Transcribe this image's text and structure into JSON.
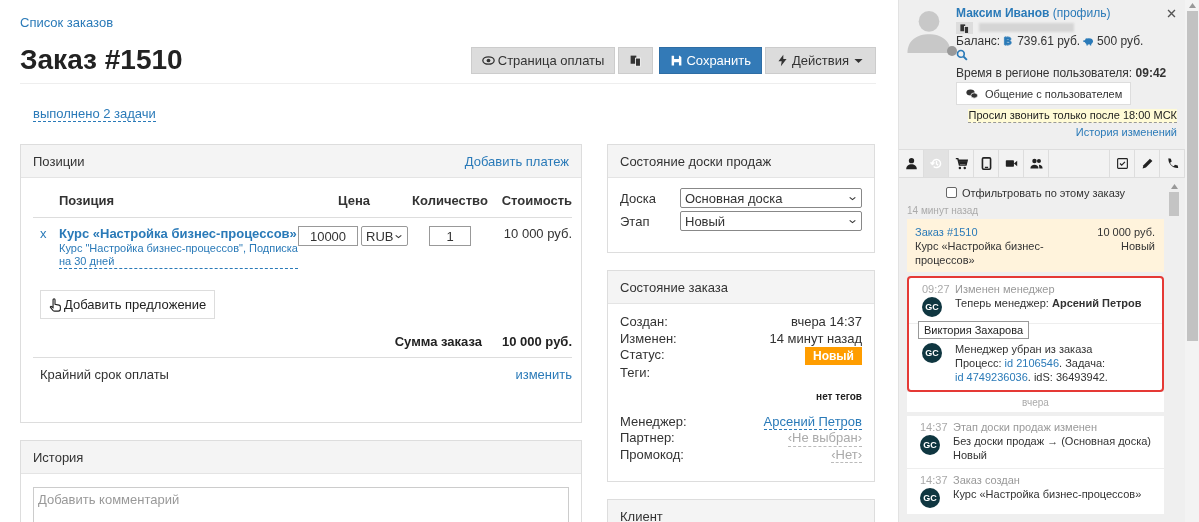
{
  "breadcrumb": "Список заказов",
  "title": "Заказ #1510",
  "toolbar": [
    {
      "kind": "eye",
      "label": "Страница оплаты"
    },
    {
      "kind": "copy"
    },
    {
      "kind": "save",
      "label": "Сохранить"
    },
    {
      "kind": "bolt",
      "label": "Действия"
    }
  ],
  "tasks_link": "выполнено 2 задачи",
  "positions": {
    "title": "Позиции",
    "action": "Добавить платеж",
    "columns": [
      "Позиция",
      "Цена",
      "Количество",
      "Стоимость"
    ],
    "rows": [
      {
        "remove": "x",
        "name": "Курс «Настройка бизнес-процессов»",
        "offer": "Курс \"Настройка бизнес-процессов\", Подписка на 30 дней",
        "price": "10000",
        "currency": "RUB",
        "quantity": "1",
        "cost": "10 000 руб."
      }
    ],
    "add_offer": "Добавить предложение",
    "total_label": "Сумма заказа",
    "total": "10 000 руб.",
    "deadline_label": "Крайний срок оплаты",
    "deadline_action": "изменить"
  },
  "history": {
    "title": "История",
    "placeholder": "Добавить комментарий"
  },
  "board": {
    "title": "Состояние доски продаж",
    "fields": [
      {
        "label": "Доска",
        "value": "Основная доска"
      },
      {
        "label": "Этап",
        "value": "Новый"
      }
    ]
  },
  "order_state": {
    "title": "Состояние заказа",
    "rows": [
      {
        "kind": "text",
        "label": "Создан:",
        "value": "вчера 14:37"
      },
      {
        "kind": "text",
        "label": "Изменен:",
        "value": "14 минут назад"
      },
      {
        "kind": "badge",
        "label": "Статус:",
        "value": "Новый"
      },
      {
        "kind": "tags",
        "label": "Теги:",
        "value": "нет тегов"
      },
      {
        "kind": "link",
        "label": "Менеджер:",
        "value": "Арсений Петров"
      },
      {
        "kind": "muted",
        "label": "Партнер:",
        "value": "‹Не выбран›"
      },
      {
        "kind": "muted",
        "label": "Промокод:",
        "value": "‹Нет›"
      }
    ]
  },
  "client": {
    "title": "Клиент"
  },
  "user": {
    "name": "Максим Иванов",
    "profile_link": "(профиль)",
    "online": false,
    "balance_label": "Баланс:",
    "balance": "739.61 руб.",
    "bonus": "500 руб.",
    "time_label": "Время в регионе пользователя:",
    "time": "09:42",
    "chat_button": "Общение с пользователем",
    "note": "Просил звонить только после 18:00 МСК",
    "history_link": "История изменений"
  },
  "tabs": [
    {
      "kind": "user",
      "selected": false
    },
    {
      "kind": "history",
      "selected": true
    },
    {
      "kind": "cart",
      "selected": false
    },
    {
      "kind": "tablet",
      "selected": false
    },
    {
      "kind": "video",
      "selected": false
    },
    {
      "kind": "users",
      "selected": false
    },
    {
      "kind": "task",
      "selected": false
    },
    {
      "kind": "pencil",
      "selected": false
    },
    {
      "kind": "phone",
      "selected": false
    }
  ],
  "filter": {
    "label": "Отфильтровать по этому заказу",
    "checked": false
  },
  "feed": [
    {
      "kind": "date",
      "label": "14 минут назад"
    },
    {
      "kind": "order",
      "title": "Заказ #1510",
      "amount": "10 000 руб.",
      "name": "Курс «Настройка бизнес-процессов»",
      "status": "Новый"
    },
    {
      "kind": "group",
      "highlighted": true,
      "events": [
        {
          "time": "09:27",
          "title": "Изменен менеджер",
          "avatar": "GC",
          "text": "Теперь менеджер: **Арсений Петров**"
        },
        {
          "avatar": "GC",
          "tooltip": "Виктория Захарова",
          "text": "Менеджер убран из заказа",
          "details": [
            {
              "kind": "text",
              "text": "Процесс: "
            },
            {
              "kind": "link",
              "text": "id 2106546"
            },
            {
              "kind": "text",
              "text": ". Задача: "
            },
            {
              "kind": "link",
              "text": "id 4749236036"
            },
            {
              "kind": "text",
              "text": ". idS: 36493942."
            }
          ]
        }
      ]
    },
    {
      "kind": "date",
      "label": "вчера"
    },
    {
      "kind": "group",
      "highlighted": false,
      "events": [
        {
          "time": "14:37",
          "title": "Этап доски продаж изменен",
          "avatar": "GC",
          "text": "Без доски продаж → (Основная доска) Новый"
        },
        {
          "time": "14:37",
          "title": "Заказ создан",
          "avatar": "GC",
          "text": "Курс «Настройка бизнес-процессов»"
        }
      ]
    }
  ]
}
